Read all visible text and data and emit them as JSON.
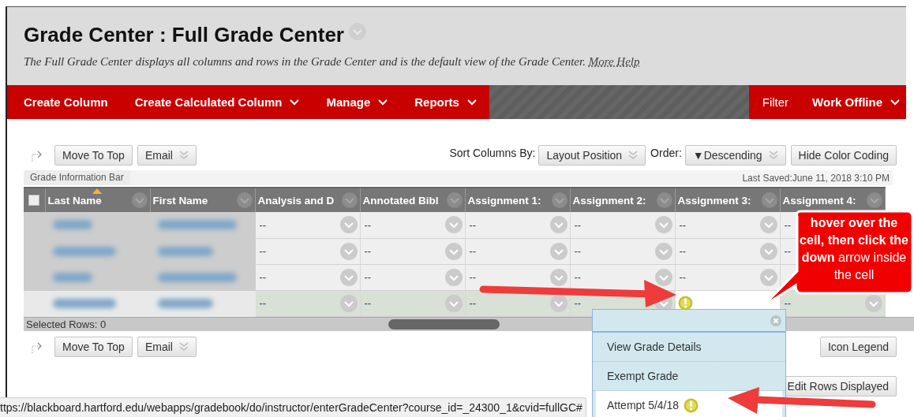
{
  "page": {
    "title": "Grade Center : Full Grade Center",
    "description": "The Full Grade Center displays all columns and rows in the Grade Center and is the default view of the Grade Center.",
    "help_link": "More Help"
  },
  "nav": {
    "left": [
      {
        "label": "Create Column",
        "has_menu": false,
        "bold": true
      },
      {
        "label": "Create Calculated Column",
        "has_menu": true,
        "bold": true
      },
      {
        "label": "Manage",
        "has_menu": true,
        "bold": true
      },
      {
        "label": "Reports",
        "has_menu": true,
        "bold": true
      }
    ],
    "right": [
      {
        "label": "Filter",
        "has_menu": false,
        "bold": false
      },
      {
        "label": "Work Offline",
        "has_menu": true,
        "bold": true
      }
    ]
  },
  "toolbar_top": {
    "buttons": [
      {
        "label": "Move To Top",
        "has_menu": false
      },
      {
        "label": "Email",
        "has_menu": true
      }
    ],
    "sort_label": "Sort Columns By:",
    "sort_value": "Layout Position",
    "order_label": "Order:",
    "order_value": "▼Descending",
    "color_button": "Hide Color Coding"
  },
  "info_bar": {
    "tab": "Grade Information Bar",
    "last_saved": "Last Saved:June 11, 2018 3:10 PM"
  },
  "table": {
    "select_all": {
      "checked": false
    },
    "columns": [
      {
        "label": "Last Name",
        "sorted": true
      },
      {
        "label": "First Name",
        "sorted": false
      },
      {
        "label": "Analysis and D",
        "sorted": false
      },
      {
        "label": "Annotated Bibl",
        "sorted": false
      },
      {
        "label": "Assignment 1:",
        "sorted": false
      },
      {
        "label": "Assignment 2:",
        "sorted": false
      },
      {
        "label": "Assignment 3:",
        "sorted": false
      },
      {
        "label": "Assignment 4:",
        "sorted": false
      }
    ],
    "rows": [
      {
        "hovered": false,
        "cells": [
          {
            "kind": "blurred"
          },
          {
            "kind": "blurred"
          },
          {
            "kind": "text",
            "text": "--"
          },
          {
            "kind": "text",
            "text": "--"
          },
          {
            "kind": "text",
            "text": "--"
          },
          {
            "kind": "text",
            "text": "--"
          },
          {
            "kind": "text",
            "text": "--"
          },
          {
            "kind": "text-only",
            "text": "--"
          }
        ]
      },
      {
        "hovered": false,
        "cells": [
          {
            "kind": "blurred"
          },
          {
            "kind": "blurred"
          },
          {
            "kind": "text",
            "text": "--"
          },
          {
            "kind": "text",
            "text": "--"
          },
          {
            "kind": "text",
            "text": "--"
          },
          {
            "kind": "text",
            "text": "--"
          },
          {
            "kind": "text",
            "text": "--"
          },
          {
            "kind": "text-only",
            "text": "--"
          }
        ]
      },
      {
        "hovered": false,
        "cells": [
          {
            "kind": "blurred"
          },
          {
            "kind": "blurred"
          },
          {
            "kind": "text",
            "text": "--"
          },
          {
            "kind": "text",
            "text": "--"
          },
          {
            "kind": "text",
            "text": "--"
          },
          {
            "kind": "text",
            "text": "--"
          },
          {
            "kind": "text",
            "text": "--"
          },
          {
            "kind": "covered"
          }
        ]
      },
      {
        "hovered": true,
        "cells": [
          {
            "kind": "blurred"
          },
          {
            "kind": "blurred"
          },
          {
            "kind": "text",
            "text": "--"
          },
          {
            "kind": "text",
            "text": "--"
          },
          {
            "kind": "text",
            "text": "--"
          },
          {
            "kind": "text",
            "text": "--"
          },
          {
            "kind": "attention"
          },
          {
            "kind": "text",
            "text": "--"
          }
        ]
      }
    ],
    "selected_rows": "Selected Rows: 0"
  },
  "toolbar_bottom": {
    "buttons": [
      {
        "label": "Move To Top",
        "has_menu": false
      },
      {
        "label": "Email",
        "has_menu": true
      }
    ],
    "legend_button": "Icon Legend",
    "rows_button": "Edit Rows Displayed"
  },
  "status_url": "ttps://blackboard.hartford.edu/webapps/gradebook/do/instructor/enterGradeCenter?course_id=_24300_1&cvid=fullGC#",
  "context_menu": {
    "items": [
      {
        "label": "View Grade Details",
        "selected": false,
        "flagged": false
      },
      {
        "label": "Exempt Grade",
        "selected": false,
        "flagged": false
      },
      {
        "label": "Attempt 5/4/18",
        "selected": true,
        "flagged": true
      }
    ]
  },
  "callout": {
    "text": "**hover over the cell, then click the down** arrow inside the cell"
  }
}
